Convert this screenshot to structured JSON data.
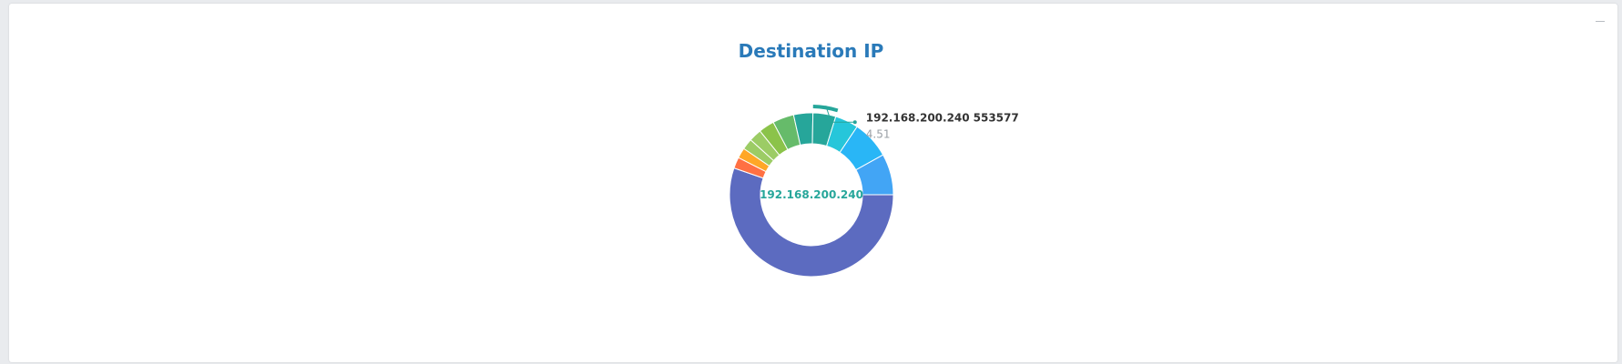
{
  "panel": {
    "collapse_icon": "minus-icon"
  },
  "chart_data": {
    "type": "pie",
    "donut": true,
    "title": "Destination IP",
    "center_label": "192.168.200.240",
    "highlight_index": 8,
    "tooltip": {
      "label": "192.168.200.240",
      "value": "553577",
      "percent": "4.51"
    },
    "series": [
      {
        "value": 55.29,
        "color": "#5c6bc0"
      },
      {
        "value": 2.2,
        "color": "#ff7043"
      },
      {
        "value": 2.05,
        "color": "#ffa726"
      },
      {
        "value": 2.15,
        "color": "#9ccc65"
      },
      {
        "value": 2.5,
        "color": "#9ccc65"
      },
      {
        "value": 3.1,
        "color": "#8bc34a"
      },
      {
        "value": 4.2,
        "color": "#66bb6a"
      },
      {
        "value": 3.8,
        "color": "#26a69a"
      },
      {
        "value": 4.51,
        "color": "#26a69a"
      },
      {
        "value": 4.6,
        "color": "#26c6da"
      },
      {
        "value": 7.5,
        "color": "#29b6f6"
      },
      {
        "value": 8.1,
        "color": "#42a5f5"
      }
    ]
  }
}
